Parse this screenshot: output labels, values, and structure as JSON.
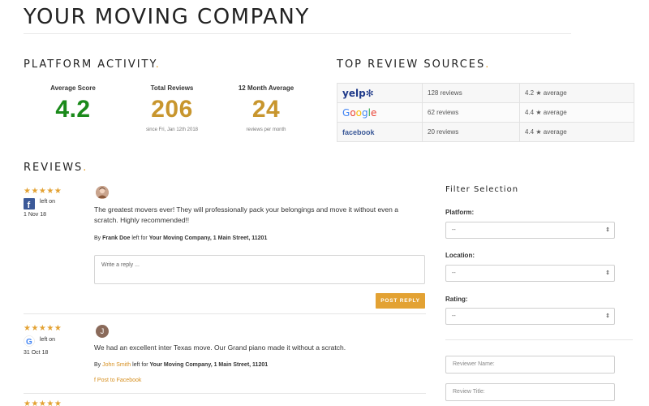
{
  "header": {
    "title": "YOUR MOVING COMPANY"
  },
  "activity": {
    "heading": "PLATFORM ACTIVITY",
    "dot": ".",
    "stats": [
      {
        "label": "Average Score",
        "value": "4.2",
        "note": "",
        "color": "#1a8a1a"
      },
      {
        "label": "Total Reviews",
        "value": "206",
        "note": "since Fri, Jan 12th 2018",
        "color": "#c8962e"
      },
      {
        "label": "12 Month Average",
        "value": "24",
        "note": "reviews per month",
        "color": "#c8962e"
      }
    ]
  },
  "sources": {
    "heading": "TOP REVIEW SOURCES",
    "dot": ".",
    "rows": [
      {
        "logo": "yelp",
        "logo_text": "yelp",
        "logo_icon": "✻",
        "reviews": "128 reviews",
        "average": "4.2 ★ average"
      },
      {
        "logo": "google",
        "logo_text": "Google",
        "reviews": "62 reviews",
        "average": "4.4 ★ average"
      },
      {
        "logo": "facebook",
        "logo_text": "facebook",
        "reviews": "20 reviews",
        "average": "4.4 ★ average"
      }
    ]
  },
  "reviews": {
    "heading": "REVIEWS",
    "dot": ".",
    "items": [
      {
        "stars": "★★★★★",
        "platform_icon": "facebook-icon",
        "left_on": "left on",
        "date": "1 Nov 18",
        "text": "The greatest movers ever! They will professionally pack your belongings and move it without even a scratch. Highly recommended!!",
        "by": "By",
        "author": "Frank Doe",
        "left_for": "left for",
        "company": "Your Moving Company, 1 Main Street, 11201",
        "reply_placeholder": "Write a reply ...",
        "post_label": "POST REPLY"
      },
      {
        "stars": "★★★★★",
        "platform_icon": "google-icon",
        "left_on": "left on",
        "date": "31 Oct 18",
        "avatar_letter": "J",
        "text": "We had an excellent inter Texas move. Our Grand piano made it without a scratch.",
        "by": "By",
        "author": "John Smith",
        "left_for": "left for",
        "company": "Your Moving Company, 1 Main Street, 11201",
        "post_fb": "Post to Facebook",
        "post_fb_icon": "f"
      }
    ]
  },
  "filter": {
    "heading": "Filter Selection",
    "platform_label": "Platform:",
    "location_label": "Location:",
    "rating_label": "Rating:",
    "select_value": "--",
    "reviewer_placeholder": "Reviewer Name:",
    "title_placeholder": "Review Title:"
  },
  "colors": {
    "accent": "#e3a233",
    "green": "#1a8a1a",
    "gold": "#c8962e",
    "facebook": "#3b5998"
  }
}
